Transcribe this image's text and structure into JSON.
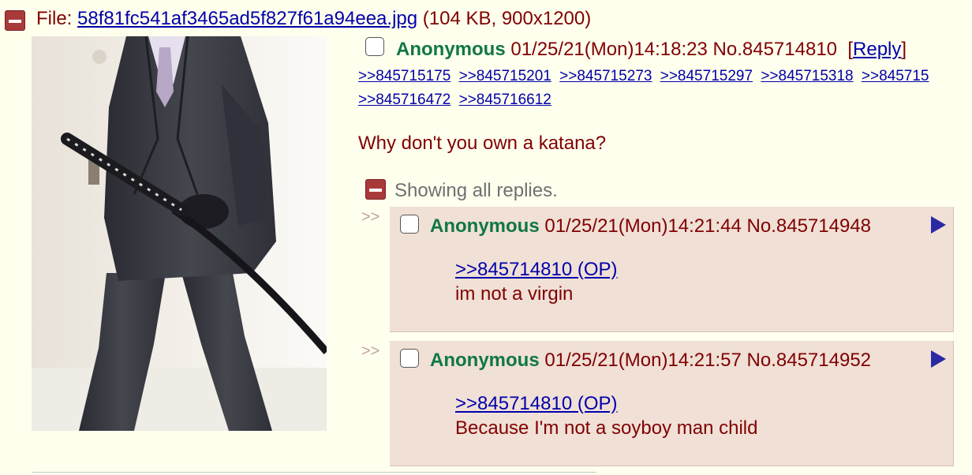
{
  "file": {
    "label": "File: ",
    "filename": "58f81fc541af3465ad5f827f61a94eea.jpg",
    "meta": " (104 KB, 900x1200)"
  },
  "op": {
    "name": "Anonymous",
    "datetime": "01/25/21(Mon)14:18:23",
    "post_no": "No.845714810",
    "reply_open": "[",
    "reply_label": "Reply",
    "reply_close": "]",
    "backlinks_row1": [
      ">>845715175",
      ">>845715201",
      ">>845715273",
      ">>845715297",
      ">>845715318",
      ">>845715"
    ],
    "backlinks_row2": [
      ">>845716472",
      ">>845716612"
    ],
    "message": "Why don't you own a katana?"
  },
  "showing_replies": "Showing all replies.",
  "replies": [
    {
      "arrow": ">>",
      "name": "Anonymous",
      "datetime": "01/25/21(Mon)14:21:44",
      "post_no": "No.845714948",
      "quote": ">>845714810 (OP)",
      "text": "im not a virgin"
    },
    {
      "arrow": ">>",
      "name": "Anonymous",
      "datetime": "01/25/21(Mon)14:21:57",
      "post_no": "No.845714952",
      "quote": ">>845714810 (OP)",
      "text": "Because I'm not a soyboy man child"
    }
  ],
  "colors": {
    "background": "#ffffee",
    "name_green": "#117743",
    "text_maroon": "#800000",
    "link_blue": "#0000aa",
    "reply_bg": "#f0e0d6",
    "hide_red": "#a93a3a"
  },
  "icons": [
    "hide-thread-icon",
    "hide-replies-icon",
    "expand-triangle-icon",
    "checkbox"
  ]
}
